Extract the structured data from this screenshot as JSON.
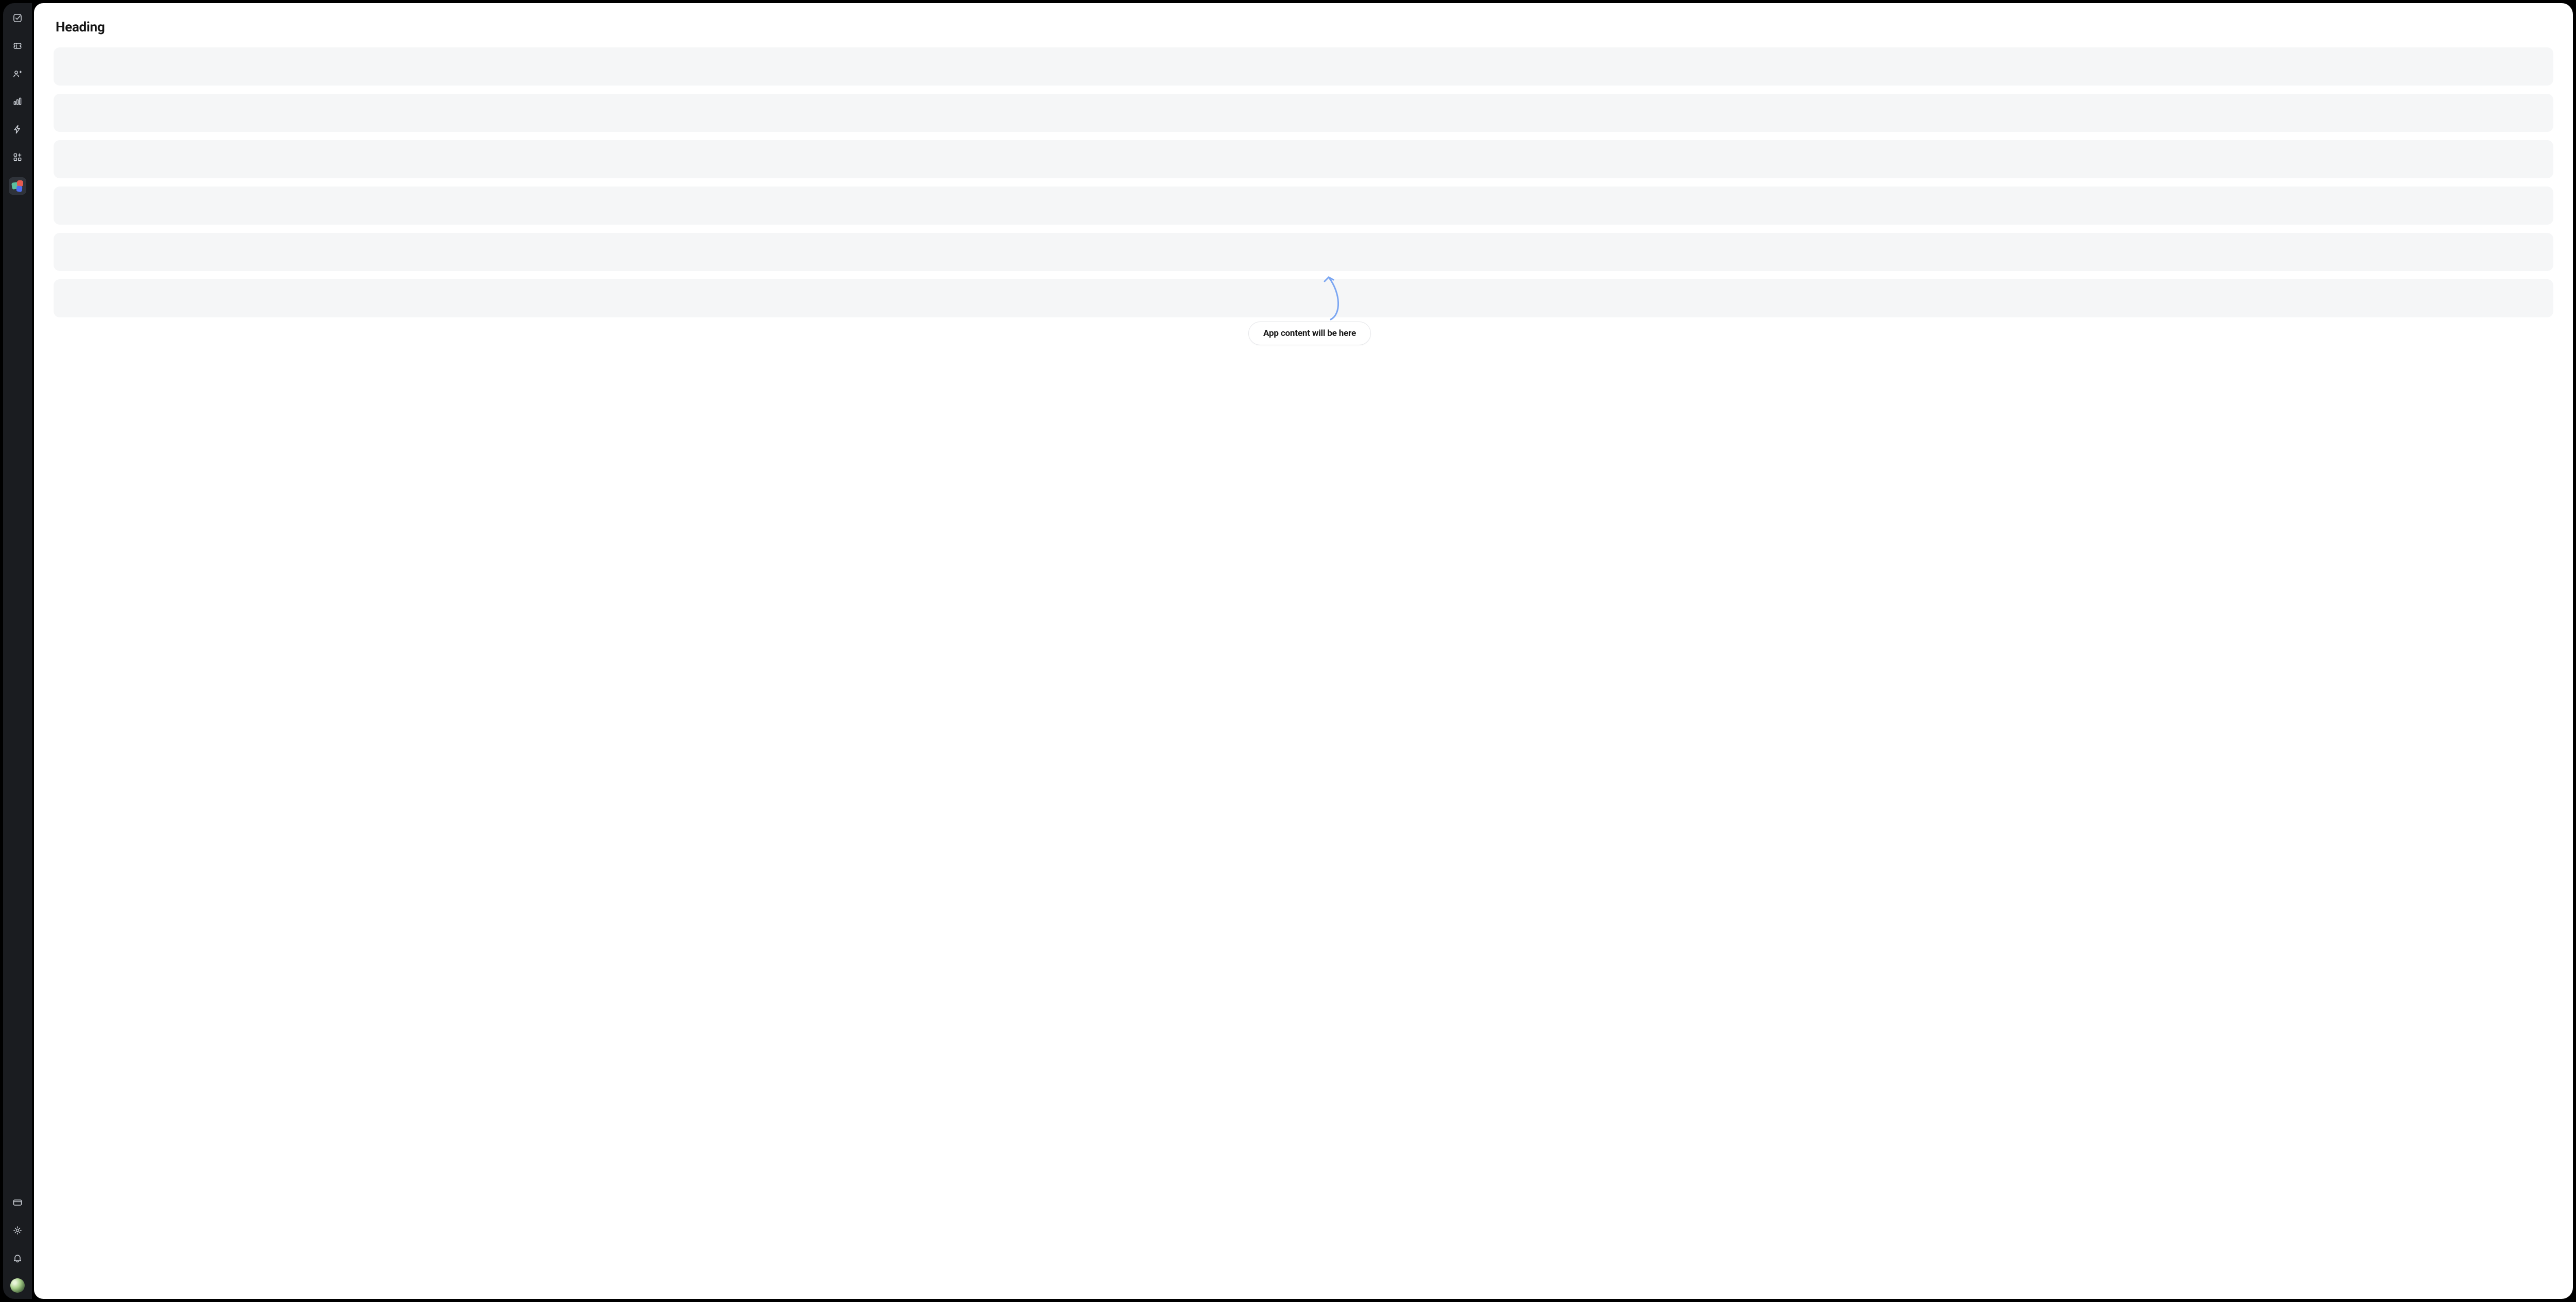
{
  "sidebar": {
    "top_items": [
      {
        "name": "checkbox-icon"
      },
      {
        "name": "ticket-icon"
      },
      {
        "name": "contacts-icon"
      },
      {
        "name": "chart-icon"
      },
      {
        "name": "bolt-icon"
      },
      {
        "name": "apps-icon"
      },
      {
        "name": "app-logo-icon",
        "active": true
      }
    ],
    "bottom_items": [
      {
        "name": "card-icon"
      },
      {
        "name": "settings-icon"
      },
      {
        "name": "bell-icon"
      }
    ]
  },
  "main": {
    "heading": "Heading",
    "placeholder_rows": 6,
    "callout_text": "App content will be here"
  },
  "colors": {
    "sidebar_bg": "#1a1c20",
    "row_bg": "#f5f6f7",
    "arrow": "#7ba6f2"
  }
}
